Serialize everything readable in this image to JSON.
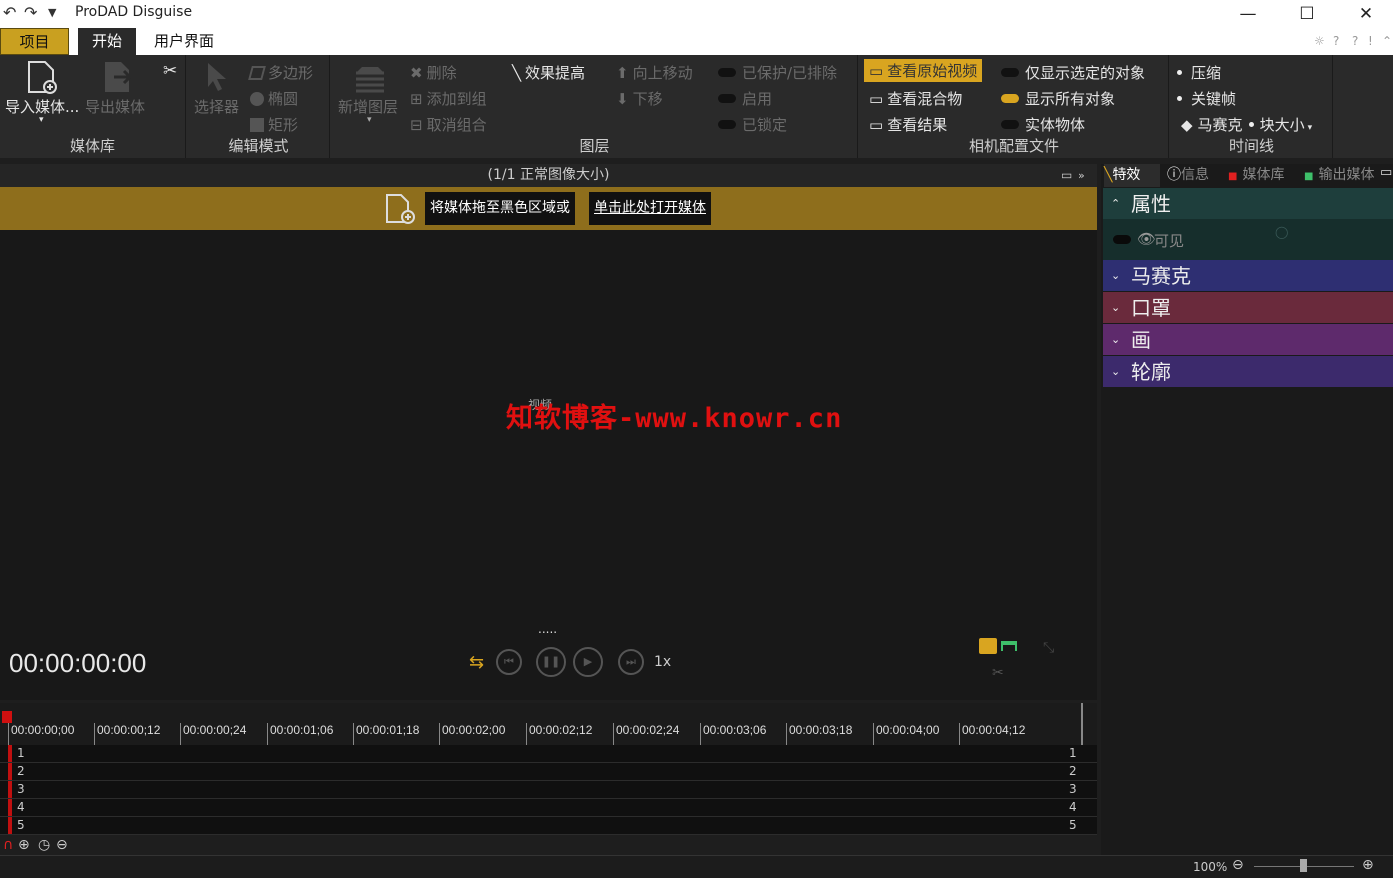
{
  "window": {
    "title": "ProDAD Disguise",
    "min": "—",
    "max": "☐",
    "close": "✕"
  },
  "tabs": {
    "project": "项目",
    "start": "开始",
    "ui": "用户界面"
  },
  "ribbon": {
    "media_lib": {
      "label": "媒体库",
      "import": "导入媒体...",
      "export": "导出媒体"
    },
    "edit_mode": {
      "label": "编辑模式",
      "selector": "选择器",
      "polygon": "多边形",
      "ellipse": "椭圆",
      "rect": "矩形"
    },
    "layer": {
      "label": "图层",
      "new_layer": "新增图层",
      "delete": "删除",
      "add_group": "添加到组",
      "ungroup": "取消组合",
      "effect_up": "效果提高",
      "move_up": "向上移动",
      "move_down": "下移",
      "protected": "已保护/已排除",
      "enable": "启用",
      "locked": "已锁定"
    },
    "camera": {
      "label": "相机配置文件",
      "view_original": "查看原始视频",
      "view_mix": "查看混合物",
      "view_result": "查看结果",
      "show_selected": "仅显示选定的对象",
      "show_all": "显示所有对象",
      "solid": "实体物体"
    },
    "timeline": {
      "label": "时间线",
      "compress": "压缩",
      "keyframe": "关键帧",
      "mosaic": "马赛克",
      "blocksize": "块大小"
    }
  },
  "viewer": {
    "header": "(1/1   正常图像大小)",
    "drop_text": "将媒体拖至黑色区域或",
    "open_link": "单击此处打开媒体",
    "center_label": "视频",
    "dots": ".....",
    "timecode": "00:00:00:00",
    "speed": "1x"
  },
  "watermark": "知软博客-www.knowr.cn",
  "ruler": [
    "00:00:00;00",
    "00:00:00;12",
    "00:00:00;24",
    "00:00:01;06",
    "00:00:01;18",
    "00:00:02;00",
    "00:00:02;12",
    "00:00:02;24",
    "00:00:03;06",
    "00:00:03;18",
    "00:00:04;00",
    "00:00:04;12"
  ],
  "tracks": [
    "1",
    "2",
    "3",
    "4",
    "5"
  ],
  "right_panel": {
    "tabs": {
      "effects": "特效",
      "info": "信息",
      "media": "媒体库",
      "output": "输出媒体"
    },
    "sections": {
      "properties": "属性",
      "visible": "可见",
      "mosaic": "马赛克",
      "mask": "口罩",
      "paint": "画",
      "outline": "轮廓"
    }
  },
  "status": {
    "zoom": "100%"
  },
  "colors": {
    "accent": "#d9a520",
    "drop_bar": "#8e6e1c",
    "mosaic": "#2e2f72",
    "mask": "#6a2a3c",
    "paint": "#5e2a6c",
    "outline": "#3c2a6c",
    "props": "#1e3e3c"
  }
}
